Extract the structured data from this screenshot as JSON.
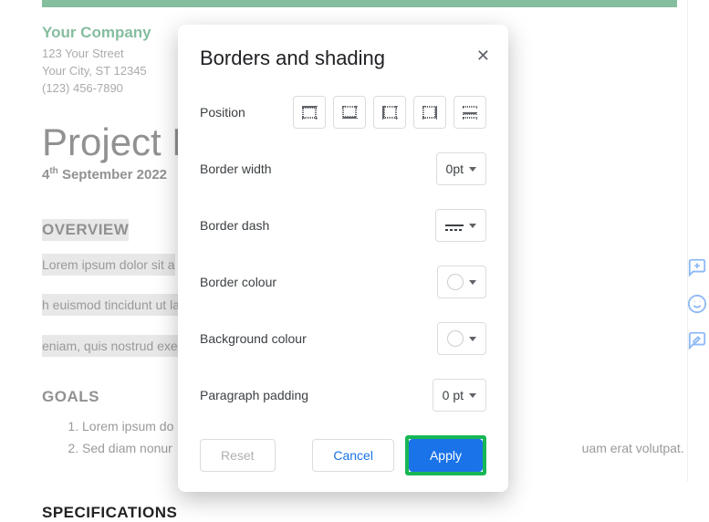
{
  "doc": {
    "company_name": "Your Company",
    "addr1": "123 Your Street",
    "addr2": "Your City, ST 12345",
    "phone": "(123) 456-7890",
    "title": "Project Name",
    "date_prefix": "4",
    "date_sup": "th",
    "date_rest": " September 2022",
    "overview_head": "OVERVIEW",
    "overview_text1": "Lorem ipsum dolor sit a",
    "overview_text_mid": "h euismod tincidunt ut laoreet dolo",
    "overview_text_end": "eniam, quis nostrud exerci tation ull",
    "goals_head": "GOALS",
    "goal1": "Lorem ipsum do",
    "goal2a": "Sed diam nonur",
    "goal2b": "uam erat volutpat.",
    "spec_head": "SPECIFICATIONS"
  },
  "dialog": {
    "title": "Borders and shading",
    "rows": {
      "position": "Position",
      "border_width": "Border width",
      "border_dash": "Border dash",
      "border_colour": "Border colour",
      "background_colour": "Background colour",
      "paragraph_padding": "Paragraph padding"
    },
    "values": {
      "border_width": "0pt",
      "paragraph_padding": "0 pt"
    },
    "buttons": {
      "reset": "Reset",
      "cancel": "Cancel",
      "apply": "Apply"
    }
  }
}
